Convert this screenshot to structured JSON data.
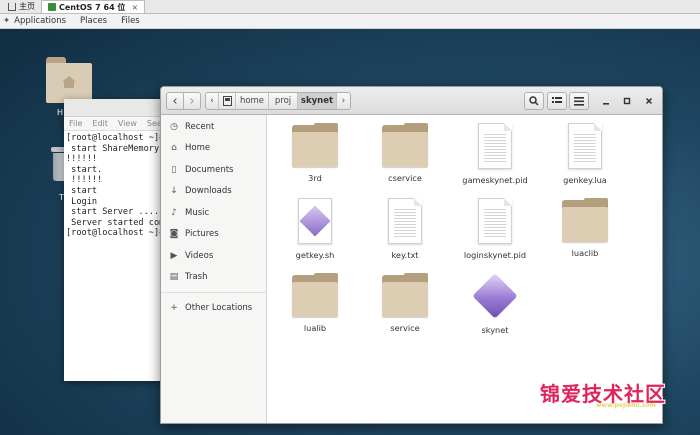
{
  "vm_tabs": [
    {
      "label": "主页",
      "icon": "home-icon",
      "active": false
    },
    {
      "label": "CentOS 7 64 位",
      "icon": "vm-icon",
      "active": true,
      "close": "×"
    }
  ],
  "gnome_bar": {
    "applications": "Applications",
    "places": "Places",
    "files": "Files"
  },
  "desktop": {
    "home_label": "H",
    "trash_label": "T"
  },
  "terminal": {
    "menu": [
      "File",
      "Edit",
      "View",
      "Searc"
    ],
    "lines": [
      "[root@localhost ~]#",
      " start ShareMemory",
      "!!!!!!",
      " start.",
      " !!!!!!",
      " start",
      " Login",
      " start Server ....",
      " Server started com",
      "[root@localhost ~]#"
    ]
  },
  "files_window": {
    "breadcrumbs": [
      "home",
      "proj",
      "skynet"
    ],
    "nav_back": "‹",
    "nav_forward": "›",
    "crumb_left": "‹",
    "crumb_right": "›",
    "sidebar": [
      {
        "label": "Recent",
        "icon": "clock-icon",
        "glyph": "◷"
      },
      {
        "label": "Home",
        "icon": "home-icon",
        "glyph": "⌂"
      },
      {
        "label": "Documents",
        "icon": "document-icon",
        "glyph": "▯"
      },
      {
        "label": "Downloads",
        "icon": "download-icon",
        "glyph": "↓"
      },
      {
        "label": "Music",
        "icon": "music-icon",
        "glyph": "♪"
      },
      {
        "label": "Pictures",
        "icon": "camera-icon",
        "glyph": "◙"
      },
      {
        "label": "Videos",
        "icon": "video-icon",
        "glyph": "▶"
      },
      {
        "label": "Trash",
        "icon": "trash-icon",
        "glyph": "▤"
      }
    ],
    "other_locations": {
      "label": "Other Locations",
      "glyph": "+"
    },
    "items": [
      {
        "label": "3rd",
        "type": "folder"
      },
      {
        "label": "cservice",
        "type": "folder"
      },
      {
        "label": "gameskynet.pid",
        "type": "text"
      },
      {
        "label": "genkey.lua",
        "type": "text"
      },
      {
        "label": "getkey.sh",
        "type": "script"
      },
      {
        "label": "key.txt",
        "type": "text"
      },
      {
        "label": "loginskynet.pid",
        "type": "text"
      },
      {
        "label": "luaclib",
        "type": "folder"
      },
      {
        "label": "lualib",
        "type": "folder"
      },
      {
        "label": "service",
        "type": "folder"
      },
      {
        "label": "skynet",
        "type": "executable"
      }
    ]
  },
  "watermark": {
    "text": "锦爱技术社区",
    "url": "www.pojiehu.com"
  }
}
